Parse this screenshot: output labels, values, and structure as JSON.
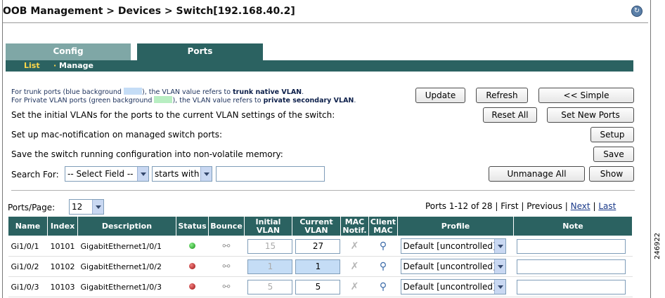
{
  "header": {
    "title": "OOB Management > Devices > Switch[192.168.40.2]",
    "help_icon": "help-icon"
  },
  "tabs": [
    {
      "label": "Config"
    },
    {
      "label": "Ports"
    }
  ],
  "subnav": {
    "list": "List",
    "separator": "·",
    "manage": "Manage"
  },
  "info": {
    "line1_pre": "For trunk ports (blue background",
    "line1_mid": "), the VLAN value refers to",
    "line1_bold": "trunk native VLAN",
    "line1_end": ".",
    "line2_pre": "For Private VLAN ports (green background",
    "line2_mid": "), the VLAN value refers to",
    "line2_bold": "private secondary VLAN",
    "line2_end": "."
  },
  "buttons": {
    "update": "Update",
    "refresh": "Refresh",
    "simple": "<< Simple",
    "reset_all": "Reset All",
    "set_new_ports": "Set New Ports",
    "setup": "Setup",
    "save": "Save",
    "unmanage_all": "Unmanage All",
    "show": "Show"
  },
  "texts": {
    "initial_vlans": "Set the initial VLANs for the ports to the current VLAN settings of the switch:",
    "mac_notification": "Set up mac-notification on managed switch ports:",
    "save_config": "Save the switch running configuration into non-volatile memory:",
    "search_for": "Search For:"
  },
  "search": {
    "field": "-- Select Field --",
    "operator": "starts with",
    "value": ""
  },
  "ports_per_page": {
    "label": "Ports/Page:",
    "value": "12"
  },
  "pager": {
    "range": "Ports 1-12 of 28",
    "sep": "|",
    "first": "First",
    "previous": "Previous",
    "next": "Next",
    "last": "Last"
  },
  "columns": [
    "Name",
    "Index",
    "Description",
    "Status",
    "Bounce",
    "Initial VLAN",
    "Current VLAN",
    "MAC Notif.",
    "Client MAC",
    "Profile",
    "Note"
  ],
  "rows": [
    {
      "name": "Gi1/0/1",
      "index": "10101",
      "description": "GigabitEthernet1/0/1",
      "status": "green",
      "initial_vlan": "15",
      "current_vlan": "27",
      "profile": "Default [uncontrolled]",
      "note": ""
    },
    {
      "name": "Gi1/0/2",
      "index": "10102",
      "description": "GigabitEthernet1/0/2",
      "status": "red",
      "initial_vlan": "1",
      "current_vlan": "1",
      "profile": "Default [uncontrolled]",
      "note": ""
    },
    {
      "name": "Gi1/0/3",
      "index": "10103",
      "description": "GigabitEthernet1/0/3",
      "status": "red",
      "initial_vlan": "5",
      "current_vlan": "5",
      "profile": "Default [uncontrolled]",
      "note": ""
    }
  ],
  "colors": {
    "teal_dark": "#2b6261",
    "teal_light": "#7fa7a6",
    "trunk_blue": "#c5ddf6",
    "pvlan_green": "#b8eec2"
  },
  "figure_number": "246922"
}
